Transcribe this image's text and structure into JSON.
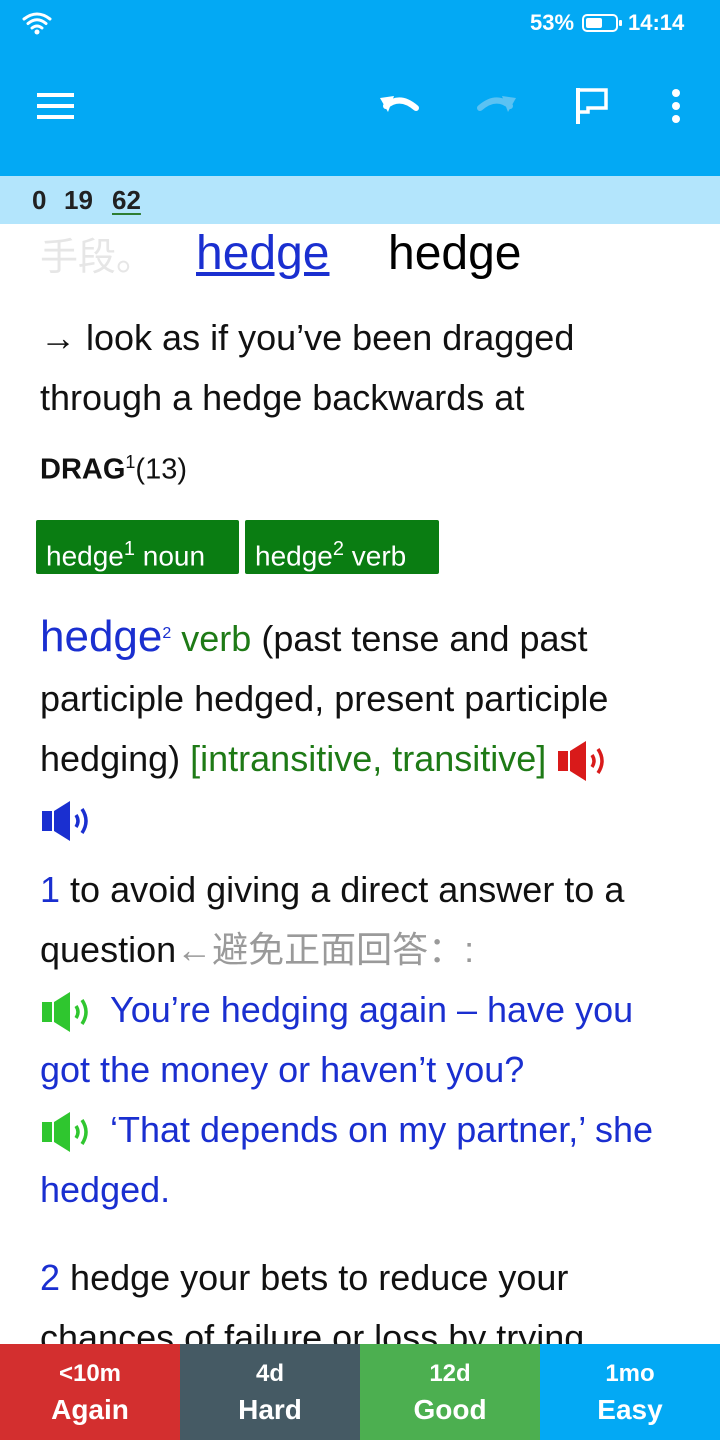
{
  "status_bar": {
    "battery_percent": "53%",
    "time": "14:14"
  },
  "toolbar": {
    "menu_icon": "hamburger-menu-icon",
    "undo_icon": "undo-icon",
    "redo_icon": "redo-icon",
    "flag_icon": "flag-icon",
    "more_icon": "more-vertical-icon"
  },
  "counts": {
    "new": "0",
    "learning": "19",
    "review": "62"
  },
  "card": {
    "faded_text": "手段。",
    "headword_link": "hedge",
    "headword": "hedge",
    "arrow_text": "→ look as if you’ve been dragged through a hedge backwards at",
    "ref_word": "DRAG",
    "ref_sup": "1",
    "ref_num": "(13)",
    "chips": [
      {
        "word": "hedge",
        "sup": "1",
        "pos": "noun"
      },
      {
        "word": "hedge",
        "sup": "2",
        "pos": "verb"
      }
    ],
    "entry": {
      "word": "hedge",
      "sup": "2",
      "pos": "verb",
      "forms": "(past tense and past participle hedged, present participle hedging)",
      "grammar": "[intransitive, transitive]"
    },
    "sense1": {
      "num": "1",
      "def": "to avoid giving a direct answer to a question",
      "cn": "←避免正面回答：:",
      "ex1": "You’re hedging again – have you got the money or haven’t you?",
      "ex2": "‘That depends on my partner,’ she hedged."
    },
    "sense2": {
      "num": "2",
      "def": "hedge your bets to reduce your chances of failure or loss by trying"
    }
  },
  "answers": [
    {
      "interval": "<10m",
      "label": "Again",
      "color": "#d32f2f"
    },
    {
      "interval": "4d",
      "label": "Hard",
      "color": "#455a64"
    },
    {
      "interval": "12d",
      "label": "Good",
      "color": "#4caf50"
    },
    {
      "interval": "1mo",
      "label": "Easy",
      "color": "#03a9f4"
    }
  ]
}
